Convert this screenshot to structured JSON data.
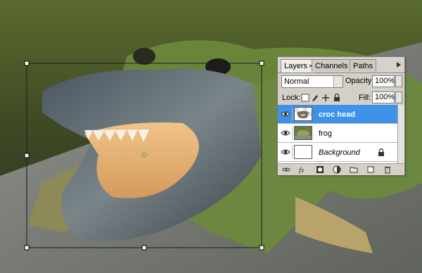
{
  "panel": {
    "tabs": [
      {
        "label": "Layers",
        "close": "×"
      },
      {
        "label": "Channels"
      },
      {
        "label": "Paths"
      }
    ],
    "blend_mode": "Normal",
    "opacity_label": "Opacity:",
    "opacity_value": "100%",
    "lock_label": "Lock:",
    "fill_label": "Fill:",
    "fill_value": "100%",
    "layers": [
      {
        "name": "croc head",
        "selected": true
      },
      {
        "name": "frog",
        "selected": false
      },
      {
        "name": "Background",
        "selected": false
      }
    ]
  },
  "icons": {
    "tab_close": "close-icon",
    "panel_menu": "panel-menu-icon",
    "visibility": "eye-icon",
    "lock": "lock-icon",
    "footer": [
      "link-icon",
      "fx-icon",
      "mask-icon",
      "adjustment-icon",
      "folder-icon",
      "new-layer-icon",
      "trash-icon"
    ]
  },
  "colors": {
    "selection": "#3e93e8",
    "panel_bg": "#d4d0c8"
  }
}
